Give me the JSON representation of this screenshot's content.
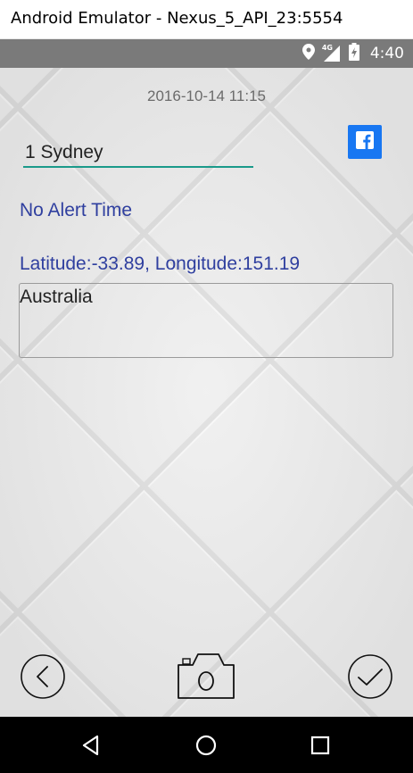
{
  "window": {
    "title": "Android Emulator - Nexus_5_API_23:5554"
  },
  "status_bar": {
    "time": "4:40",
    "network_label": "4G",
    "icons": [
      "location-icon",
      "signal-icon",
      "battery-icon"
    ]
  },
  "entry": {
    "datetime": "2016-10-14 11:15",
    "place_name": "1 Sydney",
    "alert_time": "No Alert Time",
    "coordinates": "Latitude:-33.89, Longitude:151.19",
    "notes": "Australia"
  },
  "actions": [
    "back-button",
    "camera-button",
    "confirm-button",
    "facebook-share-button"
  ],
  "nav_bar": [
    "nav-back",
    "nav-home",
    "nav-recents"
  ],
  "colors": {
    "accent": "#1a9a8a",
    "label_blue": "#2f3f9f",
    "facebook": "#1877f2",
    "status_bar": "#7a7a7a"
  }
}
